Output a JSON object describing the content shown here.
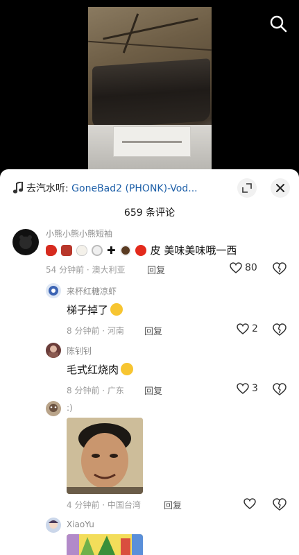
{
  "music": {
    "prefix": "去汽水听: ",
    "song": "GoneBad2 (PHONK)-Vod..."
  },
  "comments_count_title": "659 条评论",
  "comments": [
    {
      "username": "小熊小熊小熊短袖",
      "text": "皮  美味美味哦一西",
      "time_location": "54 分钟前 · 澳大利亚",
      "reply": "回复",
      "likes": "80",
      "emoji_icons": [
        "chili-pepper-icon",
        "meat-icon",
        "egg-icon",
        "rice-bowl-icon",
        "plus-icon",
        "coffee-icon",
        "apple-icon"
      ]
    },
    {
      "username": "来杯红糖凉虾",
      "text": "梯子掉了",
      "time_location": "8 分钟前 · 河南",
      "reply": "回复",
      "likes": "2",
      "emoji_icons": [
        "hugging-face-icon"
      ]
    },
    {
      "username": "陈钊钊",
      "text": "毛式红烧肉",
      "time_location": "8 分钟前 · 广东",
      "reply": "回复",
      "likes": "3",
      "emoji_icons": [
        "grinning-face-icon"
      ]
    },
    {
      "username": ":)",
      "text": "",
      "time_location": "4 分钟前 · 中国台湾",
      "reply": "回复",
      "likes": "",
      "emoji_icons": [
        "meme-photo"
      ]
    },
    {
      "username": "XiaoYu",
      "text": "",
      "time_location": "",
      "reply": "",
      "likes": "",
      "emoji_icons": [
        "cartoon-image"
      ]
    }
  ],
  "colors": {
    "song_link": "#1d5fa8",
    "sheet_bg": "#ffffff",
    "meta_gray": "#9b9b9b",
    "chili_red": "#d62b1f",
    "emoji_yellow": "#f7c531"
  },
  "icons": {
    "top_right": "search-icon",
    "music": "music-note-icon",
    "pip": "picture-in-picture-icon",
    "close": "close-icon",
    "like": "heart-icon",
    "dislike": "broken-heart-icon"
  }
}
